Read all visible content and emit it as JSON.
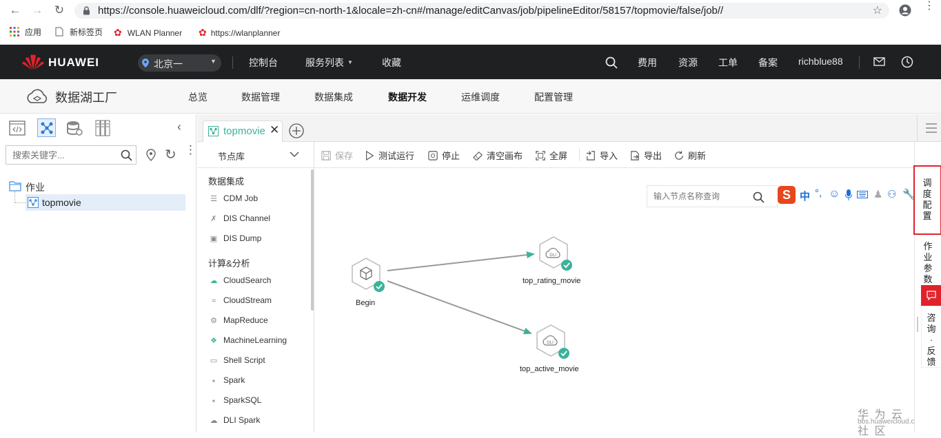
{
  "browser": {
    "url": "https://console.huaweicloud.com/dlf/?region=cn-north-1&locale=zh-cn#/manage/editCanvas/job/pipelineEditor/58157/topmovie/false/job//",
    "bookmarks": [
      {
        "label": "应用",
        "icon": "apps-grid-icon"
      },
      {
        "label": "新标签页",
        "icon": "page-icon"
      },
      {
        "label": "WLAN Planner",
        "icon": "huawei-logo-icon"
      },
      {
        "label": "https://wlanplanner",
        "icon": "huawei-logo-icon"
      }
    ]
  },
  "topnav": {
    "brand": "HUAWEI",
    "region": "北京一",
    "items": [
      "控制台",
      "服务列表",
      "收藏"
    ],
    "right_items": [
      "费用",
      "资源",
      "工单",
      "备案",
      "richblue88"
    ]
  },
  "subnav": {
    "product": "数据湖工厂",
    "tabs": [
      "总览",
      "数据管理",
      "数据集成",
      "数据开发",
      "运维调度",
      "配置管理"
    ],
    "active": "数据开发"
  },
  "leftpanel": {
    "search_placeholder": "搜索关键字...",
    "folder": "作业",
    "job": "topmovie"
  },
  "editor": {
    "tab_label": "topmovie",
    "nodelib_title": "节点库",
    "categories": [
      {
        "name": "数据集成",
        "nodes": [
          "CDM Job",
          "DIS Channel",
          "DIS Dump"
        ]
      },
      {
        "name": "计算&分析",
        "nodes": [
          "CloudSearch",
          "CloudStream",
          "MapReduce",
          "MachineLearning",
          "Shell Script",
          "Spark",
          "SparkSQL",
          "DLI Spark"
        ]
      }
    ],
    "toolbar": [
      "保存",
      "测试运行",
      "停止",
      "清空画布",
      "全屏",
      "导入",
      "导出",
      "刷新"
    ],
    "node_search_placeholder": "输入节点名称查询",
    "canvas_nodes": [
      "Begin",
      "top_rating_movie",
      "top_active_movie"
    ]
  },
  "rightbar": {
    "schedule": "调度配置",
    "params": "作业参数",
    "feedback": "咨询·反馈"
  },
  "ime": {
    "label": "中"
  },
  "watermark": {
    "title": "华 为 云 社 区",
    "sub": "bbs.huaweicloud.com"
  },
  "colors": {
    "accent": "#3bb39a",
    "nav_bg": "#1f2022",
    "highlight_red": "#e1222b"
  }
}
